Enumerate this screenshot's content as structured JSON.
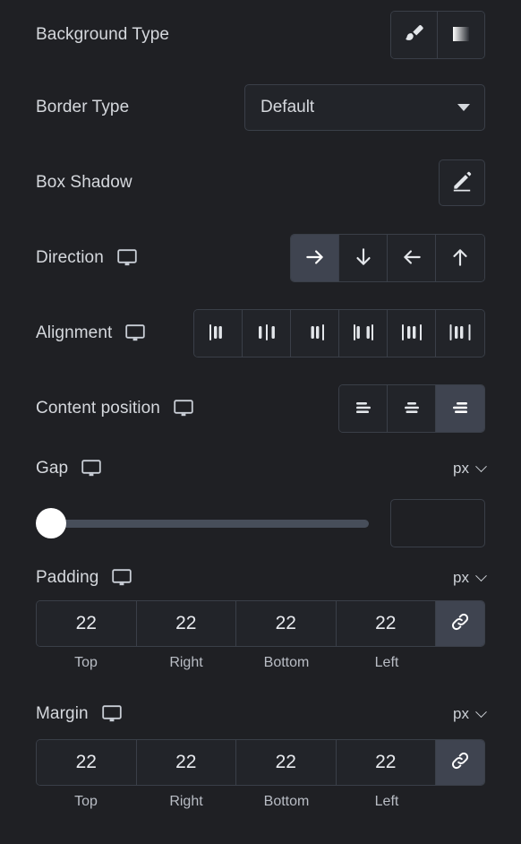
{
  "rows": {
    "background_type": {
      "label": "Background Type",
      "options": [
        {
          "name": "classic",
          "icon": "paint-brush-icon",
          "selected": false
        },
        {
          "name": "gradient",
          "icon": "gradient-swatch-icon",
          "selected": false
        }
      ]
    },
    "border_type": {
      "label": "Border Type",
      "value": "Default",
      "icon": "chevron-down-icon"
    },
    "box_shadow": {
      "label": "Box Shadow",
      "edit_icon": "pencil-edit-icon"
    },
    "direction": {
      "label": "Direction",
      "device_icon": "desktop-monitor-icon",
      "options": [
        {
          "name": "row",
          "icon": "arrow-right-icon",
          "selected": true
        },
        {
          "name": "column",
          "icon": "arrow-down-icon",
          "selected": false
        },
        {
          "name": "row-reverse",
          "icon": "arrow-left-icon",
          "selected": false
        },
        {
          "name": "column-reverse",
          "icon": "arrow-up-icon",
          "selected": false
        }
      ]
    },
    "alignment": {
      "label": "Alignment",
      "device_icon": "desktop-monitor-icon",
      "options": [
        {
          "name": "flex-start",
          "icon": "justify-start-icon",
          "selected": false
        },
        {
          "name": "center",
          "icon": "justify-center-icon",
          "selected": false
        },
        {
          "name": "flex-end",
          "icon": "justify-end-icon",
          "selected": false
        },
        {
          "name": "space-between",
          "icon": "justify-space-between-icon",
          "selected": false
        },
        {
          "name": "space-around",
          "icon": "justify-space-around-icon",
          "selected": false
        },
        {
          "name": "space-evenly",
          "icon": "justify-space-evenly-icon",
          "selected": false
        }
      ]
    },
    "content_position": {
      "label": "Content position",
      "device_icon": "desktop-monitor-icon",
      "options": [
        {
          "name": "start",
          "icon": "align-left-icon",
          "selected": false
        },
        {
          "name": "center",
          "icon": "align-center-icon",
          "selected": false
        },
        {
          "name": "end",
          "icon": "align-right-icon",
          "selected": true
        }
      ]
    },
    "gap": {
      "label": "Gap",
      "device_icon": "desktop-monitor-icon",
      "unit": "px",
      "unit_icon": "chevron-down-icon",
      "slider_value": 0,
      "slider_min": 0,
      "slider_max": 100,
      "input_value": "",
      "input_placeholder": ""
    },
    "padding": {
      "label": "Padding",
      "device_icon": "desktop-monitor-icon",
      "unit": "px",
      "unit_icon": "chevron-down-icon",
      "link_icon": "link-chain-icon",
      "linked": true,
      "fields": [
        {
          "label": "Top",
          "value": "22"
        },
        {
          "label": "Right",
          "value": "22"
        },
        {
          "label": "Bottom",
          "value": "22"
        },
        {
          "label": "Left",
          "value": "22"
        }
      ]
    },
    "margin": {
      "label": "Margin",
      "device_icon": "desktop-monitor-icon",
      "unit": "px",
      "unit_icon": "chevron-down-icon",
      "link_icon": "link-chain-icon",
      "linked": true,
      "fields": [
        {
          "label": "Top",
          "value": "22"
        },
        {
          "label": "Right",
          "value": "22"
        },
        {
          "label": "Bottom",
          "value": "22"
        },
        {
          "label": "Left",
          "value": "22"
        }
      ]
    }
  },
  "colors": {
    "background": "#1f2024",
    "control_bg": "#222429",
    "border": "#3a3f48",
    "text": "#d5d8dd",
    "text_dim": "#b9bdc5",
    "active_bg": "#3f4450",
    "slider_track": "#474e5a",
    "slider_knob": "#ffffff"
  }
}
